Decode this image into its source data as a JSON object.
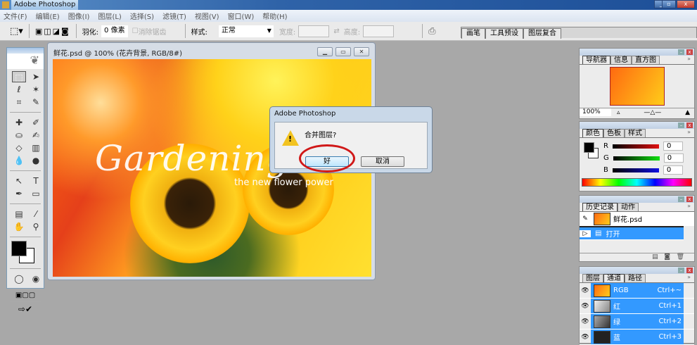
{
  "app": {
    "title": "Adobe Photoshop"
  },
  "menu": [
    "文件(F)",
    "编辑(E)",
    "图像(I)",
    "图层(L)",
    "选择(S)",
    "滤镜(T)",
    "视图(V)",
    "窗口(W)",
    "帮助(H)"
  ],
  "options": {
    "feather_label": "羽化:",
    "feather_value": "0 像素",
    "antialias_label": "消除锯齿",
    "style_label": "样式:",
    "style_value": "正常",
    "width_label": "宽度:",
    "height_label": "高度:",
    "palette_tabs": [
      "画笔",
      "工具预设",
      "图层复合"
    ]
  },
  "document": {
    "title": "鲜花.psd @ 100% (花卉背景, RGB/8#)",
    "headline": "Gardening C",
    "tagline": "the new flower power"
  },
  "dialog": {
    "title": "Adobe Photoshop",
    "message": "合并图层?",
    "ok": "好",
    "cancel": "取消"
  },
  "navigator": {
    "tabs": [
      "导航器",
      "信息",
      "直方图"
    ],
    "zoom": "100%"
  },
  "color": {
    "tabs": [
      "颜色",
      "色板",
      "样式"
    ],
    "channels": [
      {
        "label": "R",
        "value": "0"
      },
      {
        "label": "G",
        "value": "0"
      },
      {
        "label": "B",
        "value": "0"
      }
    ]
  },
  "history": {
    "tabs": [
      "历史记录",
      "动作"
    ],
    "snapshot": "鲜花.psd",
    "items": [
      "打开"
    ]
  },
  "channels": {
    "tabs": [
      "图层",
      "通道",
      "路径"
    ],
    "rows": [
      {
        "name": "RGB",
        "shortcut": "Ctrl+~"
      },
      {
        "name": "红",
        "shortcut": "Ctrl+1"
      },
      {
        "name": "绿",
        "shortcut": "Ctrl+2"
      },
      {
        "name": "蓝",
        "shortcut": "Ctrl+3"
      }
    ]
  }
}
